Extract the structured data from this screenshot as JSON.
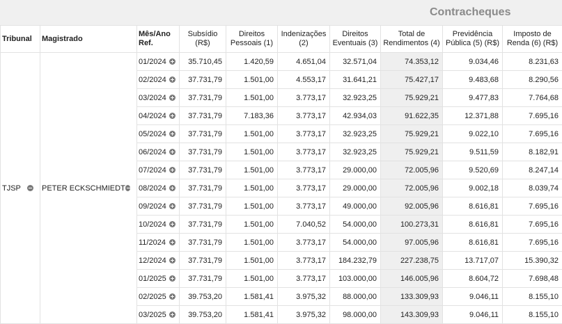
{
  "report": {
    "title": "Contracheques"
  },
  "columns": {
    "tribunal": "Tribunal",
    "magistrado": "Magistrado",
    "mes": "Mês/Ano Ref.",
    "subsidio": "Subsídio (R$)",
    "direitos_pessoais": "Direitos Pessoais (1)",
    "indenizacoes": "Indenizações (2)",
    "direitos_eventuais": "Direitos Eventuais (3)",
    "total_rendimentos": "Total de Rendimentos (4)",
    "previdencia": "Previdência Pública (5) (R$)",
    "imposto": "Imposto de Renda (6) (R$)"
  },
  "group": {
    "tribunal": "TJSP",
    "magistrado": "PETER ECKSCHMIEDT"
  },
  "rows": [
    {
      "mes": "01/2024",
      "subsidio": "35.710,45",
      "pessoais": "1.420,59",
      "indenizacoes": "4.651,04",
      "eventuais": "32.571,04",
      "total": "74.353,12",
      "previdencia": "9.034,46",
      "imposto": "8.231,63"
    },
    {
      "mes": "02/2024",
      "subsidio": "37.731,79",
      "pessoais": "1.501,00",
      "indenizacoes": "4.553,17",
      "eventuais": "31.641,21",
      "total": "75.427,17",
      "previdencia": "9.483,68",
      "imposto": "8.290,56"
    },
    {
      "mes": "03/2024",
      "subsidio": "37.731,79",
      "pessoais": "1.501,00",
      "indenizacoes": "3.773,17",
      "eventuais": "32.923,25",
      "total": "75.929,21",
      "previdencia": "9.477,83",
      "imposto": "7.764,68"
    },
    {
      "mes": "04/2024",
      "subsidio": "37.731,79",
      "pessoais": "7.183,36",
      "indenizacoes": "3.773,17",
      "eventuais": "42.934,03",
      "total": "91.622,35",
      "previdencia": "12.371,88",
      "imposto": "7.695,16"
    },
    {
      "mes": "05/2024",
      "subsidio": "37.731,79",
      "pessoais": "1.501,00",
      "indenizacoes": "3.773,17",
      "eventuais": "32.923,25",
      "total": "75.929,21",
      "previdencia": "9.022,10",
      "imposto": "7.695,16"
    },
    {
      "mes": "06/2024",
      "subsidio": "37.731,79",
      "pessoais": "1.501,00",
      "indenizacoes": "3.773,17",
      "eventuais": "32.923,25",
      "total": "75.929,21",
      "previdencia": "9.511,59",
      "imposto": "8.182,91"
    },
    {
      "mes": "07/2024",
      "subsidio": "37.731,79",
      "pessoais": "1.501,00",
      "indenizacoes": "3.773,17",
      "eventuais": "29.000,00",
      "total": "72.005,96",
      "previdencia": "9.520,69",
      "imposto": "8.247,14"
    },
    {
      "mes": "08/2024",
      "subsidio": "37.731,79",
      "pessoais": "1.501,00",
      "indenizacoes": "3.773,17",
      "eventuais": "29.000,00",
      "total": "72.005,96",
      "previdencia": "9.002,18",
      "imposto": "8.039,74"
    },
    {
      "mes": "09/2024",
      "subsidio": "37.731,79",
      "pessoais": "1.501,00",
      "indenizacoes": "3.773,17",
      "eventuais": "49.000,00",
      "total": "92.005,96",
      "previdencia": "8.616,81",
      "imposto": "7.695,16"
    },
    {
      "mes": "10/2024",
      "subsidio": "37.731,79",
      "pessoais": "1.501,00",
      "indenizacoes": "7.040,52",
      "eventuais": "54.000,00",
      "total": "100.273,31",
      "previdencia": "8.616,81",
      "imposto": "7.695,16"
    },
    {
      "mes": "11/2024",
      "subsidio": "37.731,79",
      "pessoais": "1.501,00",
      "indenizacoes": "3.773,17",
      "eventuais": "54.000,00",
      "total": "97.005,96",
      "previdencia": "8.616,81",
      "imposto": "7.695,16"
    },
    {
      "mes": "12/2024",
      "subsidio": "37.731,79",
      "pessoais": "1.501,00",
      "indenizacoes": "3.773,17",
      "eventuais": "184.232,79",
      "total": "227.238,75",
      "previdencia": "13.717,07",
      "imposto": "15.390,32"
    },
    {
      "mes": "01/2025",
      "subsidio": "37.731,79",
      "pessoais": "1.501,00",
      "indenizacoes": "3.773,17",
      "eventuais": "103.000,00",
      "total": "146.005,96",
      "previdencia": "8.604,72",
      "imposto": "7.698,48"
    },
    {
      "mes": "02/2025",
      "subsidio": "39.753,20",
      "pessoais": "1.581,41",
      "indenizacoes": "3.975,32",
      "eventuais": "88.000,00",
      "total": "133.309,93",
      "previdencia": "9.046,11",
      "imposto": "8.155,10"
    },
    {
      "mes": "03/2025",
      "subsidio": "39.753,20",
      "pessoais": "1.581,41",
      "indenizacoes": "3.975,32",
      "eventuais": "98.000,00",
      "total": "143.309,93",
      "previdencia": "9.046,11",
      "imposto": "8.155,10"
    }
  ]
}
